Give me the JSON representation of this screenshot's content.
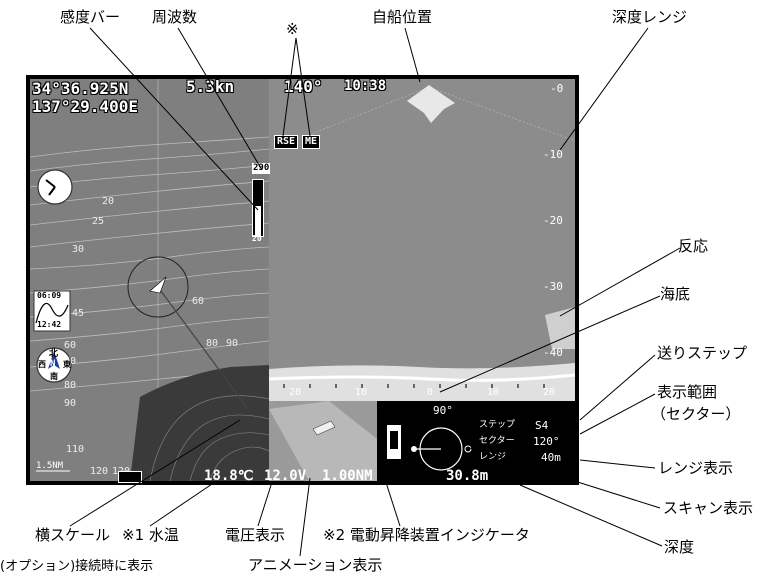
{
  "callouts": {
    "sensitivity_bar": "感度バー",
    "frequency": "周波数",
    "note_mark": "※",
    "own_ship": "自船位置",
    "depth_range": "深度レンジ",
    "echo": "反応",
    "seabed": "海底",
    "feed_step": "送りステップ",
    "display_range": "表示範囲",
    "display_range_sub": "（セクター）",
    "range_display": "レンジ表示",
    "scan_display": "スキャン表示",
    "depth": "深度",
    "horizontal_scale": "横スケール",
    "water_temp": "※1 水温",
    "voltage_display": "電圧表示",
    "lift_indicator": "※2 電動昇降装置インジケータ",
    "animation_display": "アニメーション表示",
    "option_note": "(オプション)接続時に表示"
  },
  "screen": {
    "lat": "34°36.925N",
    "lon": "137°29.400E",
    "speed": "5.3kn",
    "heading": "140°",
    "time": "10:38",
    "freq_value": "290",
    "freq_low": "20",
    "rse_badge": "RSE",
    "me_badge": "ME",
    "tide_time_top": "06:09",
    "tide_time_bottom": "12:42",
    "compass_n": "北",
    "compass_w": "西",
    "compass_e": "東",
    "compass_s": "南",
    "compass_n_letter": "N",
    "chart_scale": "1.5NM",
    "depth_contours": [
      "20",
      "25",
      "30",
      "45",
      "60",
      "70",
      "80",
      "90",
      "110",
      "120",
      "120",
      "60",
      "80",
      "90"
    ],
    "depth_scale": [
      "-0",
      "-10",
      "-20",
      "-30",
      "-40"
    ],
    "horiz_scale": [
      "20",
      "10",
      "0",
      "10",
      "20"
    ],
    "water_temp": "18.8℃",
    "voltage": "12.0V",
    "distance": "1.00NM",
    "depth_value": "30.8m",
    "sector_angle": "90°",
    "step_label": "ステップ",
    "step_value": "S4",
    "sector_label": "セクター",
    "sector_value": "120°",
    "range_label": "レンジ",
    "range_value": "40m"
  }
}
